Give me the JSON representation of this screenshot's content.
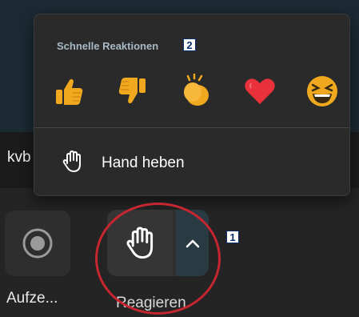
{
  "background": {
    "partial_text": "kvb"
  },
  "popup": {
    "title": "Schnelle Reaktionen",
    "title_badge": "2",
    "reactions": [
      {
        "name": "thumbs-up",
        "color": "#f0a91f"
      },
      {
        "name": "thumbs-down",
        "color": "#f0a91f"
      },
      {
        "name": "clapping-hands",
        "color": "#f0a91f"
      },
      {
        "name": "heart",
        "color": "#e8313a"
      },
      {
        "name": "laughing-face",
        "color": "#f0a91f"
      }
    ],
    "raise_hand_label": "Hand heben"
  },
  "toolbar": {
    "record_label": "Aufze...",
    "react_label": "Reagieren",
    "react_badge": "1"
  },
  "colors": {
    "accent_red": "#c6262f",
    "emoji_yellow": "#f0a91f",
    "heart_red": "#e8313a"
  }
}
